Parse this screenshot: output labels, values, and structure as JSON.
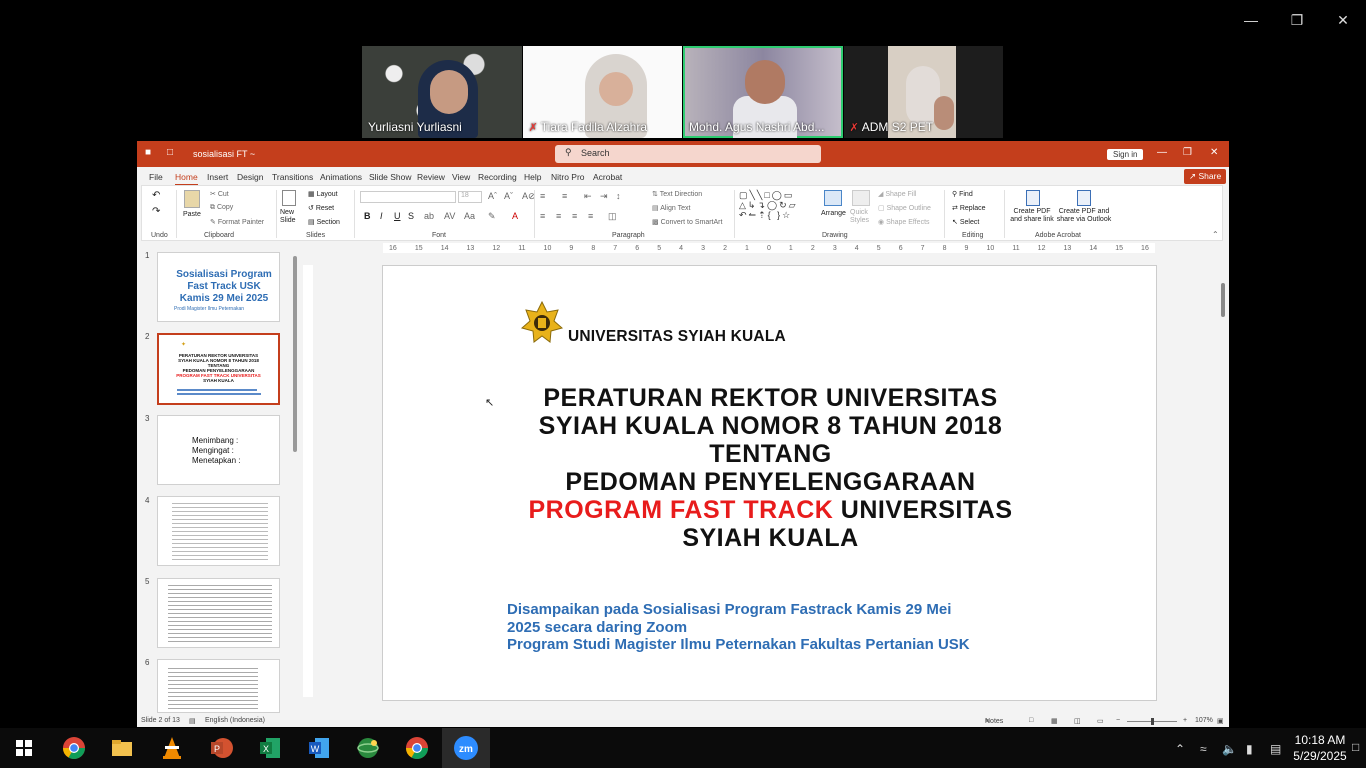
{
  "zoom": {
    "participants": [
      {
        "name": "Yurliasni Yurliasni",
        "muted": false
      },
      {
        "name": "Tiara Fadila Alzahra",
        "muted": true
      },
      {
        "name": "Mohd. Agus Nashri Abd...",
        "muted": false,
        "active": true
      },
      {
        "name": "ADM S2 PET",
        "muted": true
      }
    ]
  },
  "ppt": {
    "doc_title": "sosialisasi FT ~",
    "search_placeholder": "Search",
    "sign_in": "Sign in",
    "share": "Share",
    "tabs": [
      "File",
      "Home",
      "Insert",
      "Design",
      "Transitions",
      "Animations",
      "Slide Show",
      "Review",
      "View",
      "Recording",
      "Help",
      "Nitro Pro",
      "Acrobat"
    ],
    "ribbon": {
      "groups": [
        "Undo",
        "Clipboard",
        "Slides",
        "Font",
        "Paragraph",
        "Drawing",
        "Editing",
        "Adobe Acrobat"
      ],
      "cut": "Cut",
      "copy": "Copy",
      "format_painter": "Format Painter",
      "paste": "Paste",
      "new_slide": "New Slide",
      "layout": "Layout",
      "reset": "Reset",
      "section": "Section",
      "font_size": "18",
      "text_direction": "Text Direction",
      "align_text": "Align Text",
      "convert_smartart": "Convert to SmartArt",
      "arrange": "Arrange",
      "quick_styles": "Quick Styles",
      "shape_fill": "Shape Fill",
      "shape_outline": "Shape Outline",
      "shape_effects": "Shape Effects",
      "find": "Find",
      "replace": "Replace",
      "select": "Select",
      "create_pdf": "Create PDF and share link",
      "create_pdf_outlook": "Create PDF and share via Outlook"
    },
    "ruler_labels": [
      "16",
      "15",
      "14",
      "13",
      "12",
      "11",
      "10",
      "9",
      "8",
      "7",
      "6",
      "5",
      "4",
      "3",
      "2",
      "1",
      "0",
      "1",
      "2",
      "3",
      "4",
      "5",
      "6",
      "7",
      "8",
      "9",
      "10",
      "11",
      "12",
      "13",
      "14",
      "15",
      "16"
    ],
    "slides": [
      {
        "num": "1",
        "title": "Sosialisasi Program Fast Track USK Kamis 29 Mei 2025",
        "sub": "Prodi Magister Ilmu Peternakan"
      },
      {
        "num": "2",
        "lines": [
          "PERATURAN REKTOR UNIVERSITAS",
          "SYIAH KUALA NOMOR 8 TAHUN 2018",
          "TENTANG",
          "PEDOMAN PENYELENGGARAAN",
          "PROGRAM FAST TRACK UNIVERSITAS",
          "SYIAH KUALA"
        ]
      },
      {
        "num": "3",
        "lines": [
          "Menimbang   :",
          "Mengingat    :",
          "Menetapkan :"
        ]
      },
      {
        "num": "4"
      },
      {
        "num": "5"
      },
      {
        "num": "6"
      }
    ],
    "current_slide": {
      "university": "UNIVERSITAS SYIAH KUALA",
      "title_line1": "PERATURAN REKTOR UNIVERSITAS",
      "title_line2": "SYIAH KUALA NOMOR 8 TAHUN 2018",
      "title_line3": "TENTANG",
      "title_line4": "PEDOMAN PENYELENGGARAAN",
      "title_red": "PROGRAM FAST TRACK",
      "title_line5_rest": " UNIVERSITAS",
      "title_line6": "SYIAH KUALA",
      "sub1": "Disampaikan pada Sosialisasi Program Fastrack Kamis 29 Mei",
      "sub2": "2025 secara daring Zoom",
      "sub3": "Program Studi Magister Ilmu Peternakan Fakultas Pertanian USK"
    },
    "status": {
      "slide_of": "Slide 2 of 13",
      "language": "English (Indonesia)",
      "notes": "Notes",
      "zoom": "107%"
    }
  },
  "taskbar": {
    "time": "10:18 AM",
    "date": "5/29/2025"
  }
}
